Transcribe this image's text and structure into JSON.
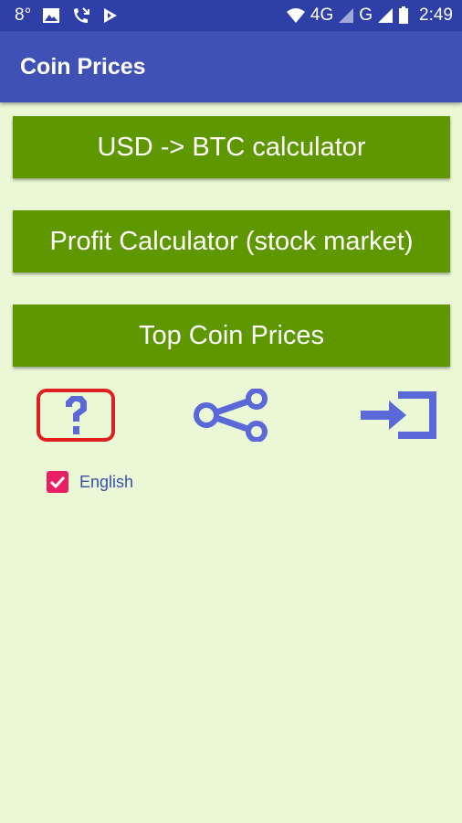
{
  "status_bar": {
    "temperature": "8°",
    "network": "4G",
    "network2": "G",
    "time": "2:49",
    "icons": [
      "image-icon",
      "missed-call-icon",
      "notification-icon",
      "wifi-icon",
      "signal-icon",
      "battery-icon"
    ]
  },
  "app_bar": {
    "title": "Coin Prices"
  },
  "buttons": [
    {
      "label": "USD -> BTC calculator"
    },
    {
      "label": "Profit Calculator (stock market)"
    },
    {
      "label": "Top Coin Prices"
    }
  ],
  "icons": {
    "help": "help-icon",
    "share": "share-icon",
    "exit": "exit-icon"
  },
  "language": {
    "label": "English",
    "checked": true
  },
  "colors": {
    "status_bar": "#2f3fa8",
    "app_bar": "#3f51b5",
    "background": "#eaf8d6",
    "button": "#5e9700",
    "checkbox": "#e91e63",
    "icon": "#5a68d8",
    "help_border": "#e02020"
  }
}
